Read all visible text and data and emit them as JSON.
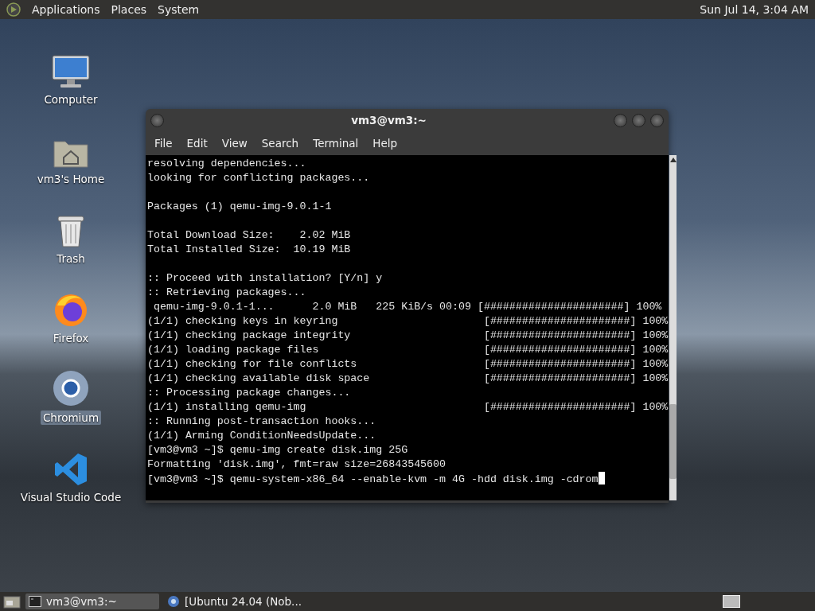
{
  "top_panel": {
    "menus": [
      "Applications",
      "Places",
      "System"
    ],
    "clock": "Sun Jul 14, 3:04 AM"
  },
  "desktop_icons": [
    {
      "label": "Computer",
      "selected": false
    },
    {
      "label": "vm3's Home",
      "selected": false
    },
    {
      "label": "Trash",
      "selected": false
    },
    {
      "label": "Firefox",
      "selected": false
    },
    {
      "label": "Chromium",
      "selected": true
    },
    {
      "label": "Visual Studio Code",
      "selected": false
    }
  ],
  "terminal": {
    "title": "vm3@vm3:~",
    "menu": [
      "File",
      "Edit",
      "View",
      "Search",
      "Terminal",
      "Help"
    ],
    "cursor": true,
    "lines": [
      {
        "kind": "text",
        "text": "resolving dependencies..."
      },
      {
        "kind": "text",
        "text": "looking for conflicting packages..."
      },
      {
        "kind": "blank"
      },
      {
        "kind": "text",
        "text": "Packages (1) qemu-img-9.0.1-1"
      },
      {
        "kind": "blank"
      },
      {
        "kind": "text",
        "text": "Total Download Size:    2.02 MiB"
      },
      {
        "kind": "text",
        "text": "Total Installed Size:  10.19 MiB"
      },
      {
        "kind": "blank"
      },
      {
        "kind": "text",
        "text": ":: Proceed with installation? [Y/n] y"
      },
      {
        "kind": "text",
        "text": ":: Retrieving packages..."
      },
      {
        "kind": "text",
        "text": " qemu-img-9.0.1-1...      2.0 MiB   225 KiB/s 00:09 [######################] 100%"
      },
      {
        "kind": "text",
        "text": "(1/1) checking keys in keyring                       [######################] 100%"
      },
      {
        "kind": "text",
        "text": "(1/1) checking package integrity                     [######################] 100%"
      },
      {
        "kind": "text",
        "text": "(1/1) loading package files                          [######################] 100%"
      },
      {
        "kind": "text",
        "text": "(1/1) checking for file conflicts                    [######################] 100%"
      },
      {
        "kind": "text",
        "text": "(1/1) checking available disk space                  [######################] 100%"
      },
      {
        "kind": "text",
        "text": ":: Processing package changes..."
      },
      {
        "kind": "text",
        "text": "(1/1) installing qemu-img                            [######################] 100%"
      },
      {
        "kind": "text",
        "text": ":: Running post-transaction hooks..."
      },
      {
        "kind": "text",
        "text": "(1/1) Arming ConditionNeedsUpdate..."
      },
      {
        "kind": "text",
        "text": "[vm3@vm3 ~]$ qemu-img create disk.img 25G"
      },
      {
        "kind": "text",
        "text": "Formatting 'disk.img', fmt=raw size=26843545600"
      },
      {
        "kind": "text",
        "text": "[vm3@vm3 ~]$ qemu-system-x86_64 --enable-kvm -m 4G -hdd disk.img -cdrom"
      }
    ]
  },
  "taskbar": {
    "items": [
      {
        "label": "vm3@vm3:~",
        "selected": true
      },
      {
        "label": "[Ubuntu 24.04 (Nob...",
        "selected": false
      }
    ]
  }
}
